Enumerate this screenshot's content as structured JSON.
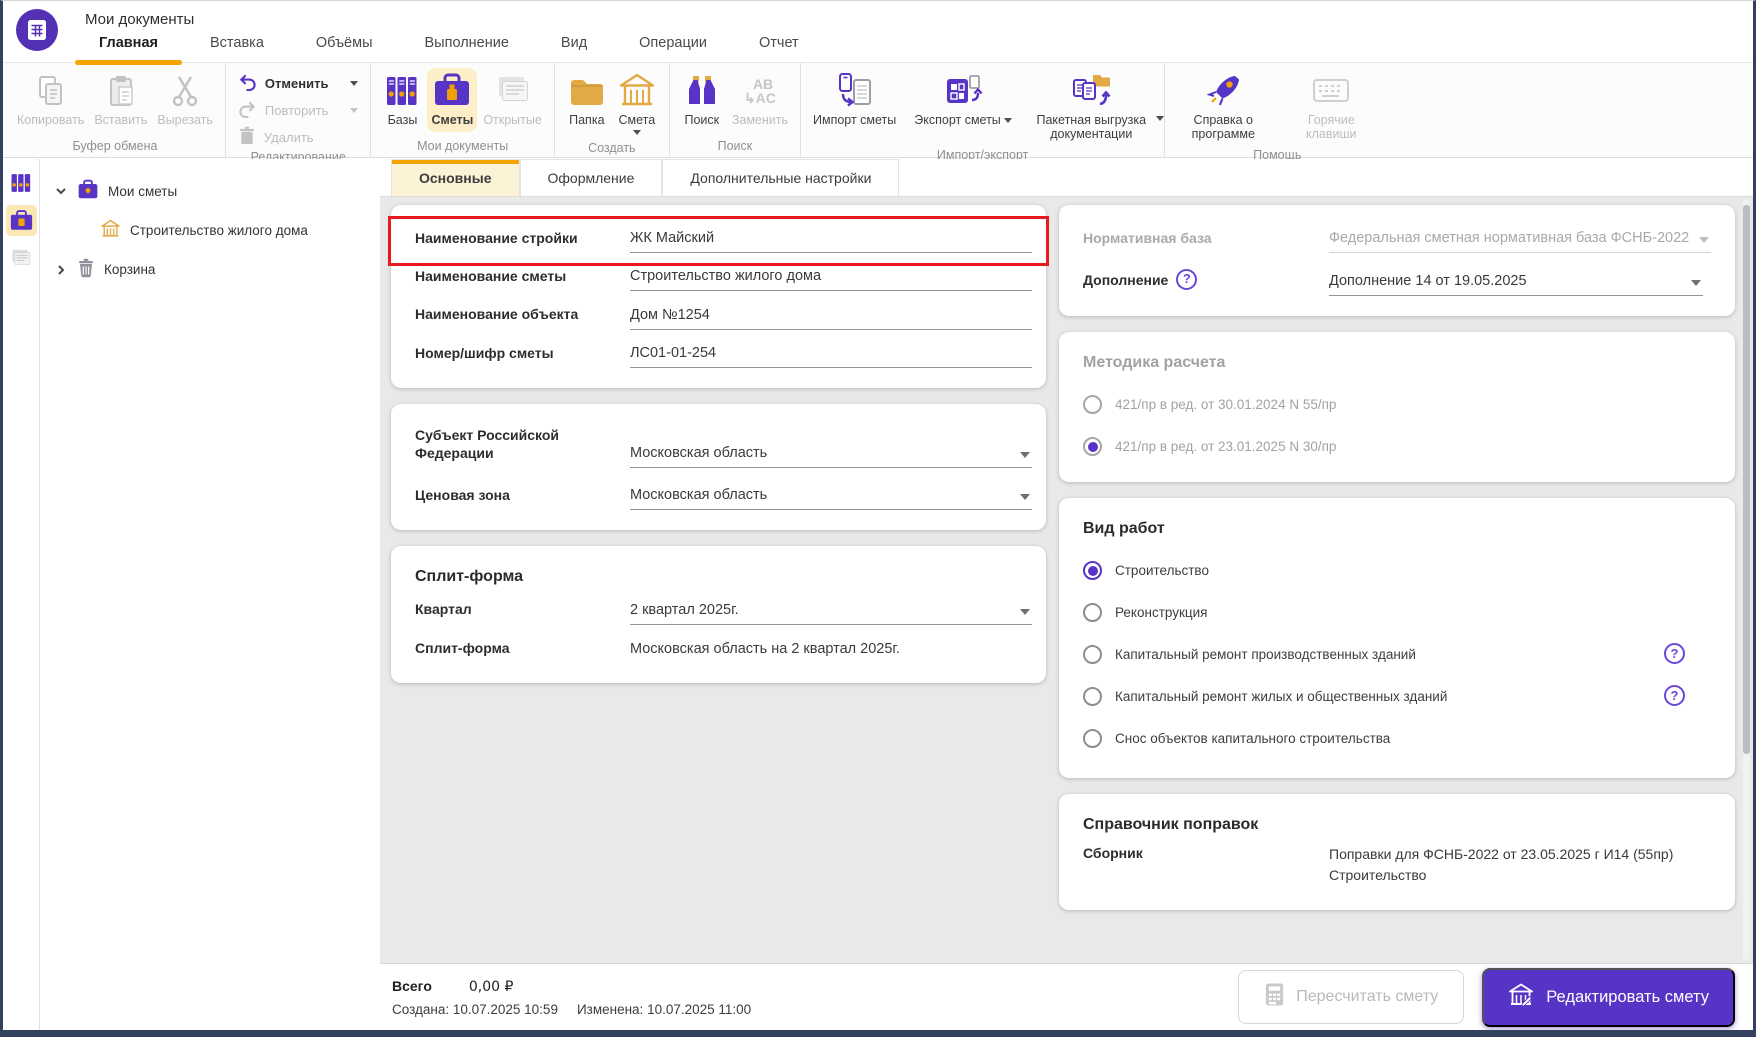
{
  "header": {
    "app_title": "Мои документы",
    "menu": [
      {
        "label": "Главная"
      },
      {
        "label": "Вставка"
      },
      {
        "label": "Объёмы"
      },
      {
        "label": "Выполнение"
      },
      {
        "label": "Вид"
      },
      {
        "label": "Операции"
      },
      {
        "label": "Отчет"
      }
    ]
  },
  "ribbon": {
    "clipboard": {
      "caption": "Буфер обмена",
      "copy": "Копировать",
      "paste": "Вставить",
      "cut": "Вырезать"
    },
    "editing": {
      "caption": "Редактирование",
      "undo": "Отменить",
      "redo": "Повторить",
      "delete": "Удалить"
    },
    "my_documents": {
      "caption": "Мои документы",
      "bases": "Базы",
      "estimates": "Сметы",
      "opened": "Открытые"
    },
    "create": {
      "caption": "Создать",
      "folder": "Папка",
      "estimate": "Смета"
    },
    "search": {
      "caption": "Поиск",
      "search": "Поиск",
      "replace": "Заменить"
    },
    "import_export": {
      "caption": "Импорт/экспорт",
      "import": "Импорт сметы",
      "export": "Экспорт сметы",
      "batch": "Пакетная выгрузка документации"
    },
    "help": {
      "caption": "Помощь",
      "about": "Справка о программе",
      "hotkeys": "Горячие клавиши"
    }
  },
  "sidebar": {
    "items": [
      {
        "label": "Мои сметы"
      },
      {
        "label": "Строительство жилого дома"
      },
      {
        "label": "Корзина"
      }
    ]
  },
  "content": {
    "tabs": [
      {
        "label": "Основные"
      },
      {
        "label": "Оформление"
      },
      {
        "label": "Дополнительные настройки"
      }
    ],
    "general": {
      "construction_name": {
        "label": "Наименование стройки",
        "value": "ЖК Майский"
      },
      "estimate_name": {
        "label": "Наименование сметы",
        "value": "Строительство жилого дома"
      },
      "object_name": {
        "label": "Наименование объекта",
        "value": "Дом №1254"
      },
      "estimate_code": {
        "label": "Номер/шифр сметы",
        "value": "ЛС01-01-254"
      }
    },
    "region": {
      "subject": {
        "label": "Субъект Российской Федерации",
        "value": "Московская область"
      },
      "price_zone": {
        "label": "Ценовая зона",
        "value": "Московская область"
      }
    },
    "split": {
      "title": "Сплит-форма",
      "quarter": {
        "label": "Квартал",
        "value": "2 квартал 2025г."
      },
      "split_form": {
        "label": "Сплит-форма",
        "value": "Московская область на 2 квартал 2025г."
      }
    }
  },
  "right_panel": {
    "base": {
      "normative_base": {
        "label": "Нормативная база",
        "value": "Федеральная сметная нормативная база ФСНБ-2022"
      },
      "supplement": {
        "label": "Дополнение",
        "value": "Дополнение 14 от 19.05.2025"
      }
    },
    "method": {
      "title": "Методика расчета",
      "options": [
        {
          "label": "421/пр в ред. от 30.01.2024 N 55/пр",
          "selected": false
        },
        {
          "label": "421/пр в ред. от 23.01.2025 N 30/пр",
          "selected": true
        }
      ]
    },
    "work_type": {
      "title": "Вид работ",
      "options": [
        {
          "label": "Строительство",
          "selected": true
        },
        {
          "label": "Реконструкция",
          "selected": false
        },
        {
          "label": "Капитальный ремонт производственных зданий",
          "selected": false
        },
        {
          "label": "Капитальный ремонт жилых и общественных зданий",
          "selected": false
        },
        {
          "label": "Снос объектов капитального строительства",
          "selected": false
        }
      ]
    },
    "corrections": {
      "title": "Справочник поправок",
      "collection_label": "Сборник",
      "collection_value": "Поправки для ФСНБ-2022 от 23.05.2025 г И14 (55пр)",
      "collection_value_line2": "Строительство"
    }
  },
  "footer": {
    "total_label": "Всего",
    "total_value": "0,00 ₽",
    "created": "Создана: 10.07.2025 10:59",
    "modified": "Изменена: 10.07.2025 11:00",
    "recalculate_button": "Пересчитать смету",
    "edit_button": "Редактировать смету"
  },
  "colors": {
    "accent_purple": "#5733c6",
    "accent_amber": "#f2a104",
    "highlight_red": "#e8191f",
    "active_tab_bg": "#fcf2d5"
  }
}
